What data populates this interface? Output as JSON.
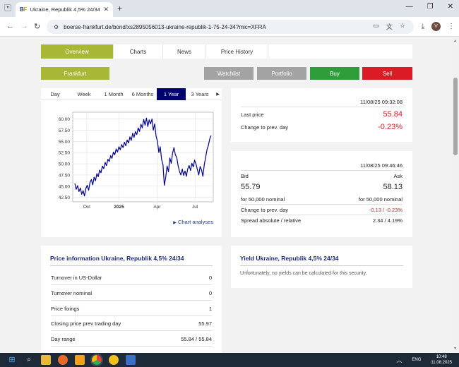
{
  "browser": {
    "tab_title": "Ukraine, Republik 4,5% 24/34 Bor",
    "tab_logo_left": "B",
    "tab_logo_right": "F",
    "url": "boerse-frankfurt.de/bond/xs2895056013-ukraine-republik-1-75-24-34?mic=XFRA",
    "avatar_letter": "V"
  },
  "nav": {
    "tabs": [
      "Overview",
      "Charts",
      "News",
      "Price History"
    ]
  },
  "actions": {
    "exchange": "Frankfurt",
    "watchlist": "Watchlist",
    "portfolio": "Portfolio",
    "buy": "Buy",
    "sell": "Sell"
  },
  "chart_panel": {
    "ranges": [
      "Day",
      "Week",
      "1 Month",
      "6 Months",
      "1 Year",
      "3 Years"
    ],
    "active_range": "1 Year",
    "link": "Chart analyses"
  },
  "chart_data": {
    "type": "line",
    "ylim": [
      41.5,
      61.5
    ],
    "yticks": [
      "60.00",
      "57.50",
      "55.00",
      "52.50",
      "50.00",
      "47.50",
      "45.00",
      "42.50"
    ],
    "ytick_values": [
      60,
      57.5,
      55,
      52.5,
      50,
      47.5,
      45,
      42.5
    ],
    "xticks": [
      "Oct",
      "2025",
      "Apr",
      "Jul"
    ],
    "xtick_positions": [
      0.1,
      0.33,
      0.6,
      0.87
    ],
    "grid": true,
    "series": [
      {
        "color": "#00008b",
        "values": [
          45.6,
          44.3,
          45.1,
          43.8,
          44.6,
          43.2,
          44.0,
          42.8,
          44.5,
          45.2,
          44.1,
          45.8,
          46.5,
          45.3,
          47.0,
          46.2,
          47.8,
          47.1,
          48.6,
          48.0,
          49.5,
          48.9,
          50.3,
          49.6,
          51.0,
          50.5,
          51.8,
          51.2,
          52.6,
          52.0,
          53.3,
          52.6,
          53.8,
          53.1,
          54.3,
          53.6,
          54.8,
          54.0,
          55.3,
          54.6,
          56.0,
          55.2,
          56.8,
          55.9,
          57.2,
          56.5,
          58.0,
          57.2,
          58.8,
          58.0,
          59.9,
          58.6,
          60.2,
          58.3,
          59.8,
          58.9,
          60.0,
          57.5,
          58.9,
          56.2,
          55.0,
          52.5,
          53.8,
          51.0,
          49.8,
          45.2,
          47.0,
          49.5,
          48.2,
          51.3,
          50.1,
          52.4,
          53.6,
          52.0,
          51.4,
          49.6,
          48.3,
          47.5,
          48.8,
          47.4,
          48.4,
          47.2,
          48.9,
          49.6,
          48.5,
          50.1,
          49.3,
          50.8,
          49.9,
          48.7,
          47.5,
          49.4,
          48.6,
          47.2,
          49.8,
          51.4,
          53.2,
          54.1,
          55.6,
          56.3
        ]
      }
    ]
  },
  "quote": {
    "timestamp": "11/08/25 09:32:08",
    "last_price_label": "Last price",
    "last_price": "55.84",
    "change_label": "Change to prev. day",
    "change": "-0.23%"
  },
  "bidask": {
    "timestamp": "11/08/25 09:46:46",
    "bid_label": "Bid",
    "ask_label": "Ask",
    "bid": "55.79",
    "ask": "58.13",
    "bid_nominal": "for 50,000 nominal",
    "ask_nominal": "for 50,000 nominal",
    "change_label": "Change to prev. day",
    "change": "-0.13 / -0.23%",
    "spread_label": "Spread absolute / relative",
    "spread": "2.34 / 4.19%"
  },
  "price_info": {
    "title": "Price information Ukraine, Republik 4,5% 24/34",
    "rows": [
      {
        "label": "Turnover in US-Dollar",
        "value": "0"
      },
      {
        "label": "Turnover nominal",
        "value": "0"
      },
      {
        "label": "Price fixings",
        "value": "1"
      },
      {
        "label": "Closing price prev trading day",
        "value": "55.97"
      },
      {
        "label": "Day range",
        "value": "55.84 / 55.84"
      }
    ]
  },
  "yield": {
    "title": "Yield Ukraine, Republik 4,5% 24/34",
    "message": "Unfortunately, no yields can be calculated for this security."
  },
  "taskbar": {
    "lang": "ENG",
    "time": "10:48",
    "date": "11.08.2025"
  },
  "colors": {
    "green_accent": "#a6b834",
    "button_grey": "#a3a3a3",
    "buy": "#2e9e3a",
    "sell": "#dc1c24",
    "active_range": "#00006e"
  }
}
